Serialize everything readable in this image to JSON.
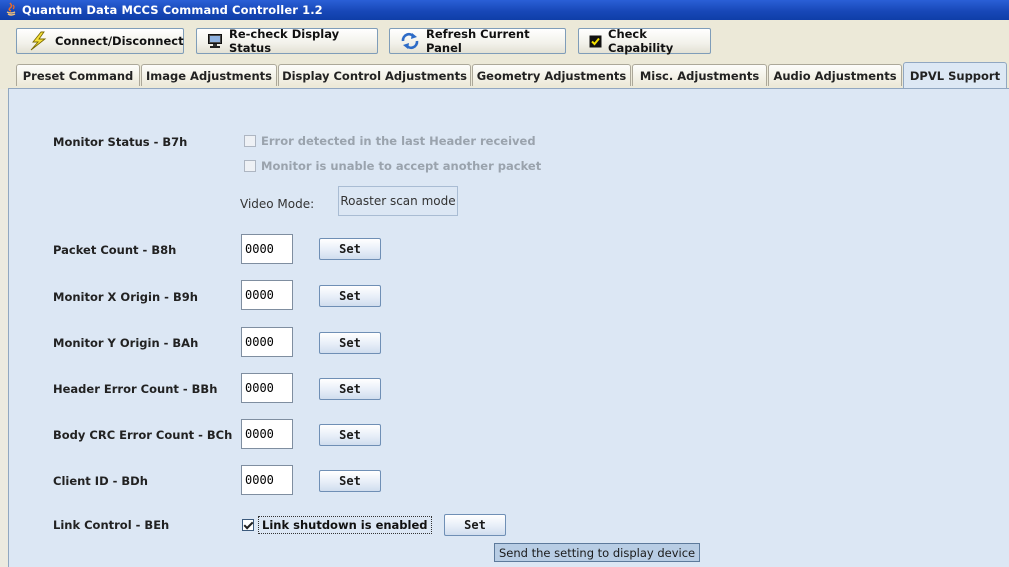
{
  "window": {
    "title": "Quantum Data MCCS Command Controller 1.2"
  },
  "toolbar": {
    "connect_label": "Connect/Disconnect",
    "recheck_label": "Re-check Display Status",
    "refresh_label": "Refresh Current Panel",
    "capability_label": "Check Capability",
    "capability_checked": true
  },
  "tabs": [
    {
      "label": "Preset Command",
      "active": false
    },
    {
      "label": "Image Adjustments",
      "active": false
    },
    {
      "label": "Display Control Adjustments",
      "active": false
    },
    {
      "label": "Geometry Adjustments",
      "active": false
    },
    {
      "label": "Misc. Adjustments",
      "active": false
    },
    {
      "label": "Audio Adjustments",
      "active": false
    },
    {
      "label": "DPVL Support",
      "active": true
    }
  ],
  "monitor_status": {
    "label": "Monitor Status - B7h",
    "error_header_label": "Error detected in the last Header received",
    "error_header_checked": false,
    "unable_packet_label": "Monitor is unable to accept another packet",
    "unable_packet_checked": false,
    "video_mode_label": "Video Mode:",
    "video_mode_value": "Roaster scan mode"
  },
  "rows": [
    {
      "label": "Packet Count - B8h",
      "value": "0000",
      "set_label": "Set"
    },
    {
      "label": "Monitor X Origin - B9h",
      "value": "0000",
      "set_label": "Set"
    },
    {
      "label": "Monitor Y Origin - BAh",
      "value": "0000",
      "set_label": "Set"
    },
    {
      "label": "Header Error Count - BBh",
      "value": "0000",
      "set_label": "Set"
    },
    {
      "label": "Body CRC Error Count - BCh",
      "value": "0000",
      "set_label": "Set"
    },
    {
      "label": "Client ID - BDh",
      "value": "0000",
      "set_label": "Set"
    }
  ],
  "link_control": {
    "label": "Link Control - BEh",
    "checkbox_label": "Link shutdown is enabled",
    "checked": true,
    "set_label": "Set",
    "tooltip": "Send the setting to display device"
  }
}
